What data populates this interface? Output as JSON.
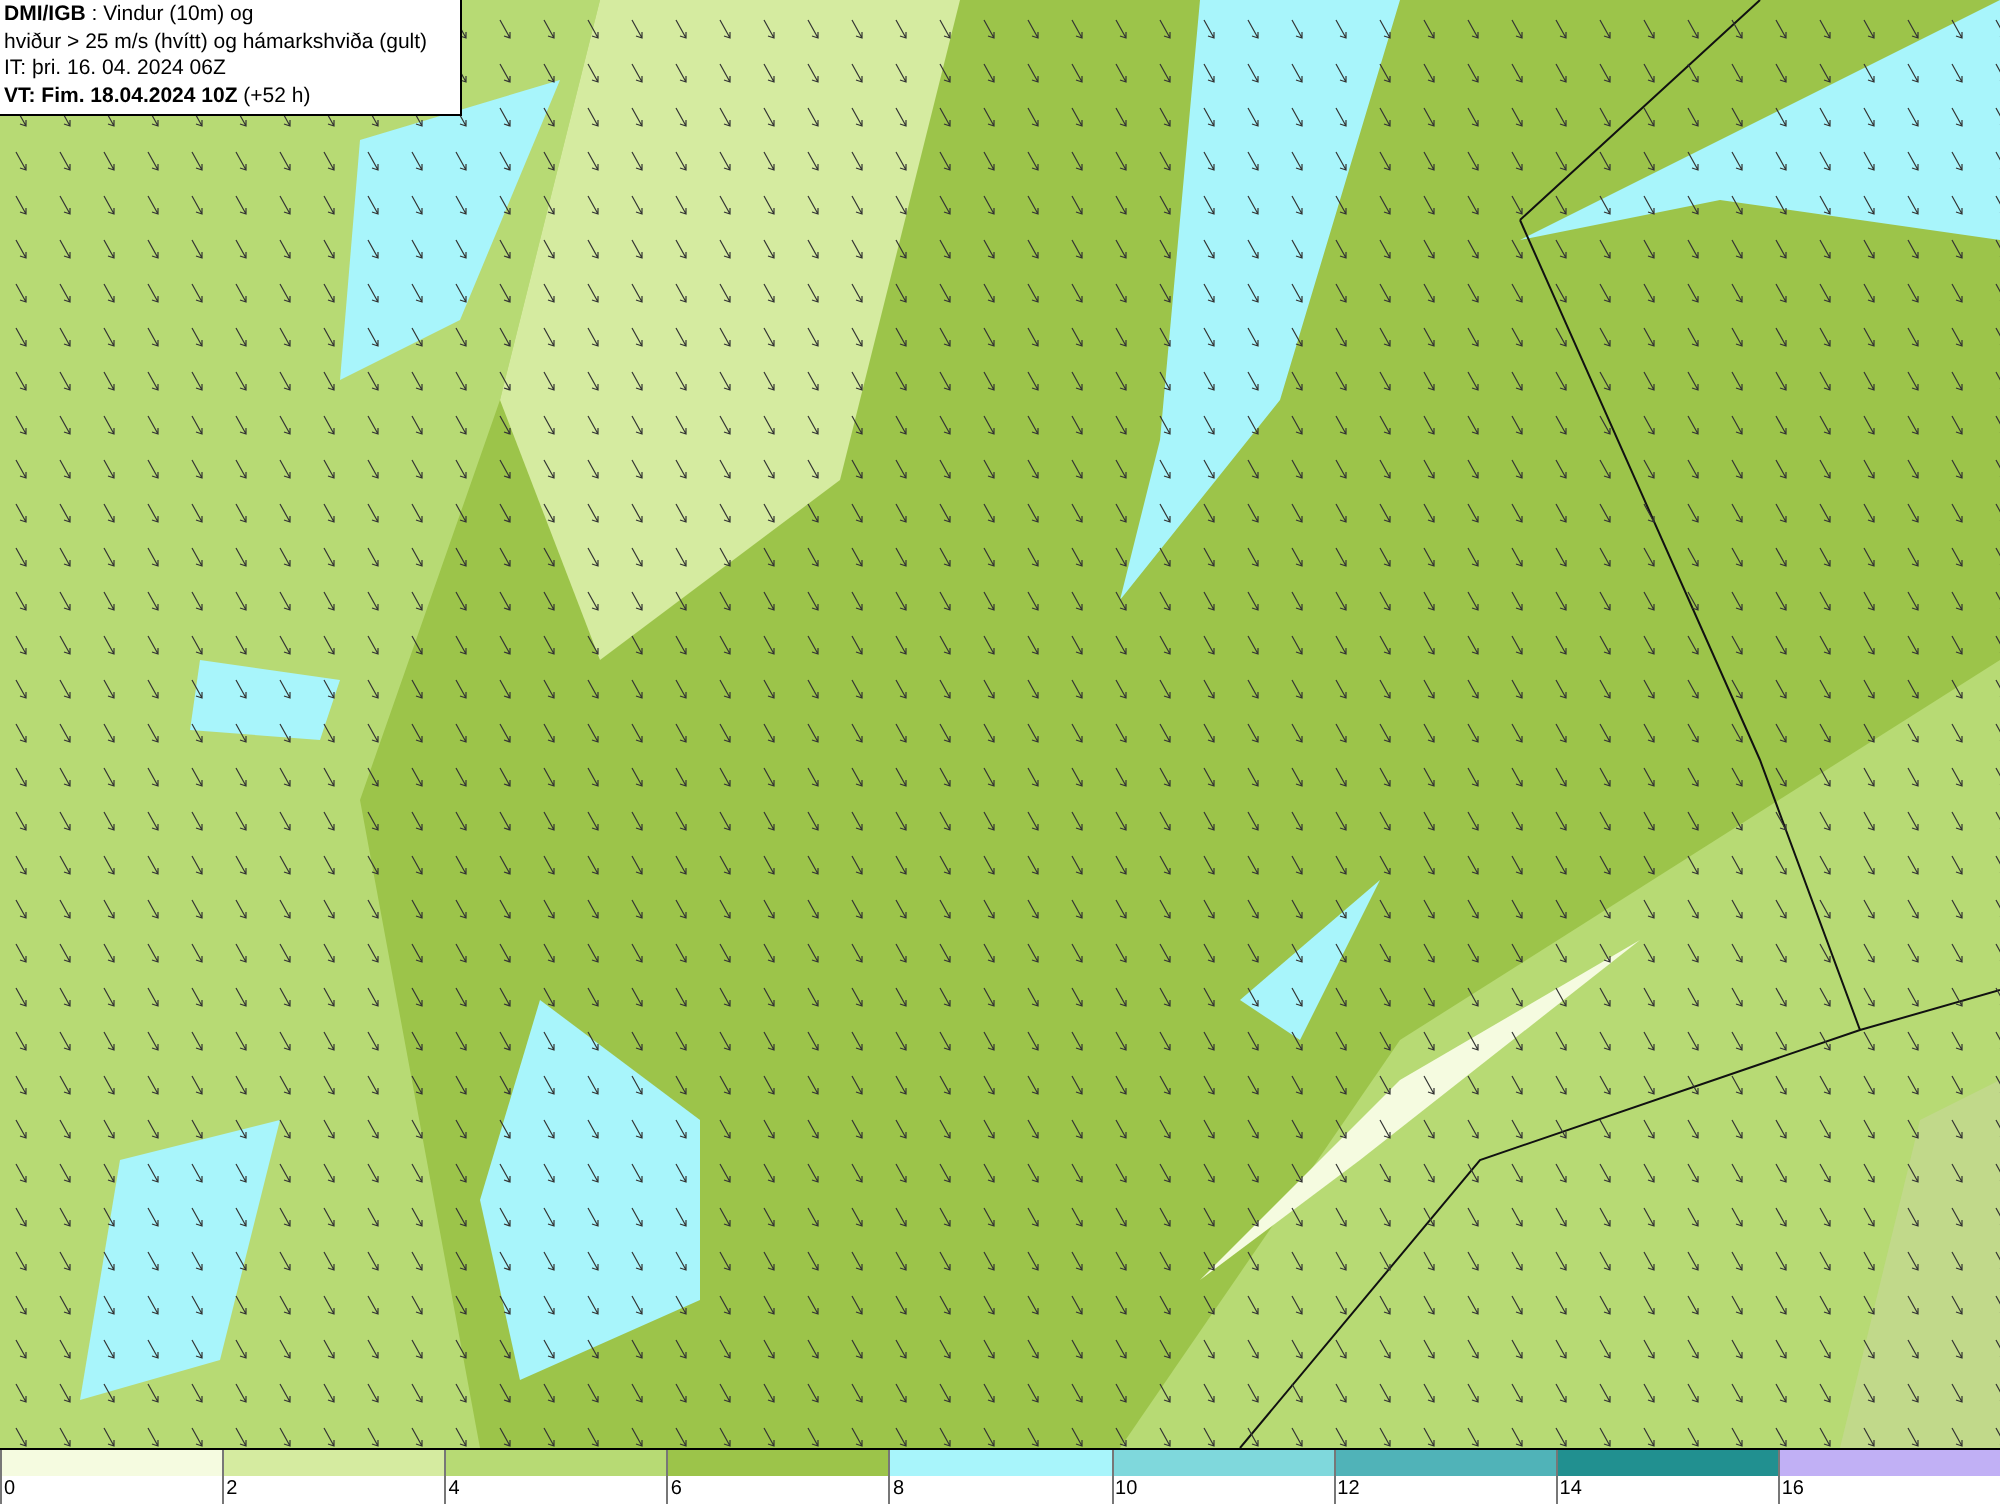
{
  "header": {
    "lines": [
      "**DMI/IGB** : Vindur (10m) og",
      "hviður > 25 m/s (hvítt) og hámarkshviða (gult)",
      "IT: þri. 16. 04. 2024 06Z",
      "**VT: Fim. 18.04.2024 10Z** (+52 h)"
    ]
  },
  "legend": [
    {
      "label": "0",
      "color": "#f5fbe0"
    },
    {
      "label": "2",
      "color": "#d5eba0"
    },
    {
      "label": "4",
      "color": "#b7da74"
    },
    {
      "label": "6",
      "color": "#9cc44a"
    },
    {
      "label": "8",
      "color": "#a8f5fb"
    },
    {
      "label": "10",
      "color": "#7fd8dc"
    },
    {
      "label": "12",
      "color": "#50b3b8"
    },
    {
      "label": "14",
      "color": "#219090"
    },
    {
      "label": "16",
      "color": "#c1b0f5"
    }
  ]
}
